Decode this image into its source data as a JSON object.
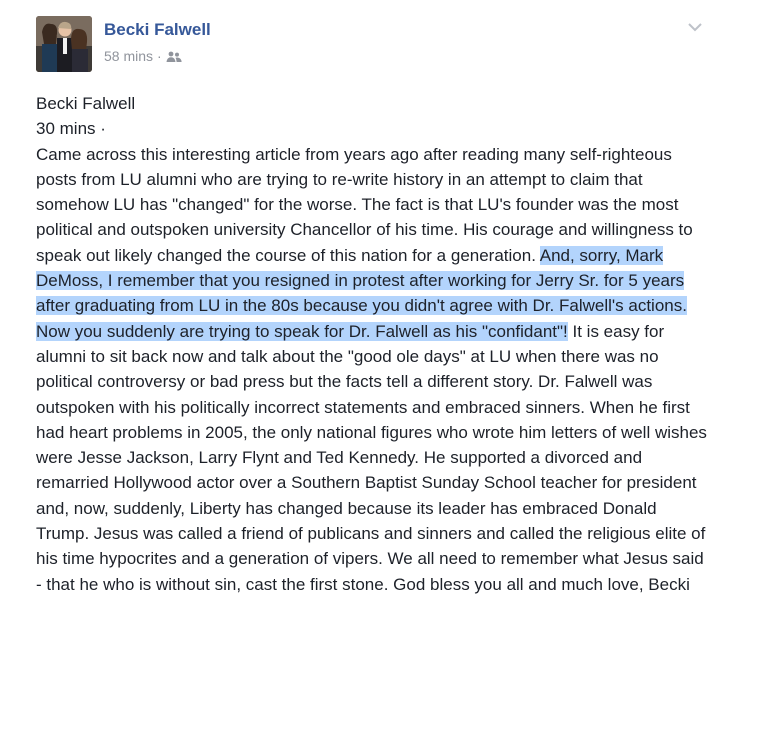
{
  "post": {
    "author_name": "Becki Falwell",
    "timestamp": "58 mins",
    "separator": "·",
    "audience_icon": "friends-icon",
    "menu_icon": "chevron-down-icon",
    "colors": {
      "author_link": "#365899",
      "meta": "#90949c",
      "text": "#1d2129",
      "selection": "#b3d4fc"
    }
  },
  "content": {
    "quoted_author": "Becki Falwell",
    "quoted_time": "30 mins ·",
    "text_before_selection": "Came across this interesting article from years ago after reading many self-righteous posts from LU alumni who are trying to re-write history in an attempt to claim that somehow LU has \"changed\" for the worse. The fact is that LU's founder was the most political and outspoken university Chancellor of his time. His courage and willingness to speak out likely changed the course of this nation for a generation.",
    "selected_text": "And, sorry, Mark DeMoss, I remember that you resigned in protest after working for Jerry Sr. for 5 years after graduating from LU in the 80s because you didn't agree with Dr. Falwell's actions. Now you suddenly are trying to speak for Dr. Falwell as his \"confidant\"!",
    "text_after_selection": "It is easy for alumni to sit back now and talk about the \"good ole days\" at LU when there was no political controversy or bad press but the facts tell a different story. Dr. Falwell was outspoken with his politically incorrect statements and embraced sinners. When he first had heart problems in 2005, the only national figures who wrote him letters of well wishes were Jesse Jackson, Larry Flynt and Ted Kennedy. He supported a divorced and remarried Hollywood actor over a Southern Baptist Sunday School teacher for president and, now, suddenly, Liberty has changed because its leader has embraced Donald Trump. Jesus was called a friend of publicans and sinners and called the religious elite of his time hypocrites and a generation of vipers. We all need to remember what Jesus said - that he who is without sin, cast the first stone. God bless you all and much love, Becki"
  }
}
